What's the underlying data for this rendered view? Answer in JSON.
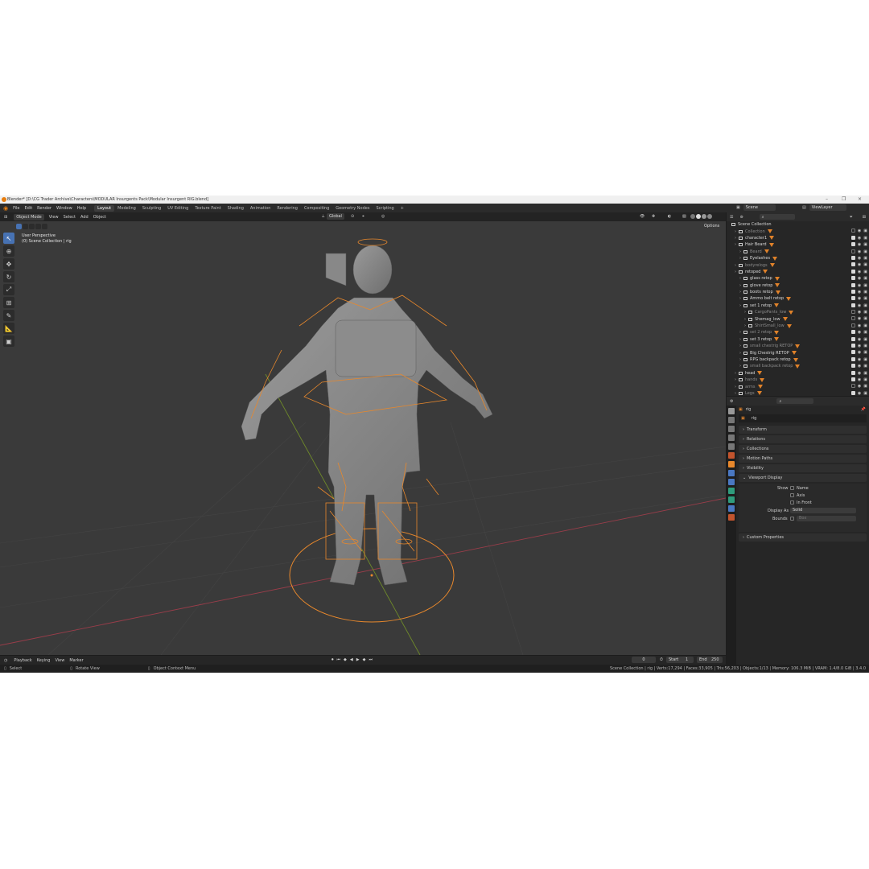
{
  "window": {
    "title": "Blender* [D:\\CG Trader Archive\\Characters\\MODULAR Insurgents Pack\\Modular Insurgent RIG.blend]",
    "minimize": "–",
    "maximize": "❐",
    "close": "×"
  },
  "menu": [
    "File",
    "Edit",
    "Render",
    "Window",
    "Help"
  ],
  "workspaces": [
    {
      "label": "Layout",
      "active": true
    },
    {
      "label": "Modeling"
    },
    {
      "label": "Sculpting"
    },
    {
      "label": "UV Editing"
    },
    {
      "label": "Texture Paint"
    },
    {
      "label": "Shading"
    },
    {
      "label": "Animation"
    },
    {
      "label": "Rendering"
    },
    {
      "label": "Compositing"
    },
    {
      "label": "Geometry Nodes"
    },
    {
      "label": "Scripting"
    }
  ],
  "scene": {
    "label": "Scene",
    "view_layer": "ViewLayer"
  },
  "viewport_header": {
    "mode": "Object Mode",
    "menus": [
      "View",
      "Select",
      "Add",
      "Object"
    ],
    "transform_orientation": "Global",
    "options": "Options"
  },
  "viewport_overlay": {
    "line1": "User Perspective",
    "line2": "(0) Scene Collection | rig"
  },
  "tools": [
    "select-box",
    "cursor",
    "move",
    "rotate",
    "scale",
    "transform",
    "annotate",
    "measure",
    "add-cube"
  ],
  "outliner": {
    "root": "Scene Collection",
    "items": [
      {
        "label": "Collection",
        "depth": 1,
        "dim": true,
        "checked": false
      },
      {
        "label": "character1",
        "depth": 1,
        "checked": true
      },
      {
        "label": "Hair Beard",
        "depth": 1,
        "checked": true
      },
      {
        "label": "Beard",
        "depth": 2,
        "dim": true,
        "checked": false
      },
      {
        "label": "Eyelashes",
        "depth": 2,
        "checked": true
      },
      {
        "label": "bodyrelogs",
        "depth": 1,
        "dim": true,
        "checked": true
      },
      {
        "label": "retoped",
        "depth": 1,
        "checked": true
      },
      {
        "label": "glass retop",
        "depth": 2,
        "checked": true
      },
      {
        "label": "glove retop",
        "depth": 2,
        "checked": true
      },
      {
        "label": "boots retop",
        "depth": 2,
        "checked": true
      },
      {
        "label": "Ammo belt retop",
        "depth": 2,
        "checked": true
      },
      {
        "label": "set 1 retop",
        "depth": 2,
        "checked": true
      },
      {
        "label": "CargoPants_low",
        "depth": 3,
        "dim": true,
        "checked": false
      },
      {
        "label": "Shemag_low",
        "depth": 3,
        "checked": false
      },
      {
        "label": "ShirtSmall_low",
        "depth": 3,
        "dim": true,
        "checked": false
      },
      {
        "label": "set 2 retop",
        "depth": 2,
        "dim": true,
        "checked": true
      },
      {
        "label": "set 3 retop",
        "depth": 2,
        "checked": true
      },
      {
        "label": "small chestrig RETOP",
        "depth": 2,
        "dim": true,
        "checked": true
      },
      {
        "label": "Big Chestrig RETOP",
        "depth": 2,
        "checked": true
      },
      {
        "label": "RPG backpack retop",
        "depth": 2,
        "checked": true
      },
      {
        "label": "small backpack retop",
        "depth": 2,
        "dim": true,
        "checked": true
      },
      {
        "label": "head",
        "depth": 1,
        "checked": true
      },
      {
        "label": "hands",
        "depth": 1,
        "dim": true,
        "checked": true
      },
      {
        "label": "arms",
        "depth": 1,
        "dim": true,
        "checked": false
      },
      {
        "label": "Legs",
        "depth": 1,
        "dim": true,
        "checked": true
      }
    ]
  },
  "properties": {
    "object_name": "rig",
    "data_name": "rig",
    "panels": [
      "Transform",
      "Relations",
      "Collections",
      "Motion Paths",
      "Visibility",
      "Viewport Display",
      "Custom Properties"
    ],
    "viewport_display": {
      "show_label": "Show",
      "name_label": "Name",
      "axis_label": "Axis",
      "in_front_label": "In Front",
      "display_as_label": "Display As",
      "display_as_value": "Solid",
      "bounds_label": "Bounds",
      "bounds_value": "Box"
    }
  },
  "timeline": {
    "menus": [
      "Playback",
      "Keying",
      "View",
      "Marker"
    ],
    "current_frame": "0",
    "start_label": "Start",
    "start": "1",
    "end_label": "End",
    "end": "250"
  },
  "statusbar": {
    "select": "Select",
    "rotate": "Rotate View",
    "context": "Object Context Menu",
    "stats": "Scene Collection | rig | Verts:17,294 | Faces:33,905 | Tris:56,203 | Objects:1/13 | Memory: 106.3 MiB | VRAM: 1.4/8.0 GiB | 3.4.0"
  },
  "colors": {
    "accent": "#4772b3",
    "rig": "#e8882c",
    "background": "#3a3a3a"
  }
}
